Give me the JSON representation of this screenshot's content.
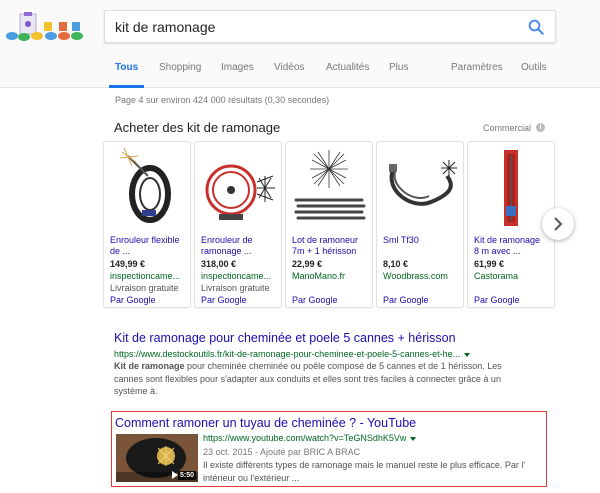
{
  "header": {
    "search_value": "kit de ramonage",
    "tabs": [
      {
        "label": "Tous",
        "active": true
      },
      {
        "label": "Shopping"
      },
      {
        "label": "Images"
      },
      {
        "label": "Vidéos"
      },
      {
        "label": "Actualités"
      },
      {
        "label": "Plus"
      },
      {
        "label": "Paramètres"
      },
      {
        "label": "Outils"
      }
    ]
  },
  "stats": "Page 4 sur environ 424 000 résultats (0,30 secondes)",
  "shopping": {
    "title": "Acheter des kit de ramonage",
    "commercial_label": "Commercial",
    "info_glyph": "i",
    "cards": [
      {
        "name_line1": "Enrouleur flexible",
        "name_line2": "de ...",
        "price": "149,99 €",
        "merchant": "inspectioncame...",
        "shipping": "Livraison gratuite",
        "by": "Par Google"
      },
      {
        "name_line1": "Enrouleur de",
        "name_line2": "ramonage ...",
        "price": "318,00 €",
        "merchant": "inspectioncame...",
        "shipping": "Livraison gratuite",
        "by": "Par Google"
      },
      {
        "name_line1": "Lot de ramoneur",
        "name_line2": "7m + 1 hérisson",
        "price": "22,99 €",
        "merchant": "ManoMano.fr",
        "shipping": "",
        "by": "Par Google"
      },
      {
        "name_line1": "Sml Tf30",
        "name_line2": "",
        "price": "8,10 €",
        "merchant": "Woodbrass.com",
        "shipping": "",
        "by": "Par Google"
      },
      {
        "name_line1": "Kit de ramonage",
        "name_line2": "8 m avec ...",
        "price": "61,99 €",
        "merchant": "Castorama",
        "shipping": "",
        "by": "Par Google"
      }
    ]
  },
  "results": [
    {
      "title": "Kit de ramonage pour cheminée et poele 5 cannes + hérisson",
      "url": "https://www.destockoutils.fr/kit-de-ramonage-pour-cheminee-et-poele-5-cannes-et-he...",
      "snippet_bold": "Kit de ramonage",
      "snippet_line1": " pour cheminée cheminée ou poêle composé de 5 cannes et de 1 hérisson. Les",
      "snippet_line2": "cannes sont flexibles pour s'adapter aux conduits et elles sont très faciles à connecter grâce à un",
      "snippet_line3": "système à."
    },
    {
      "title": "Comment ramoner un tuyau de cheminée ? - YouTube",
      "url": "https://www.youtube.com/watch?v=TeGNSdhK5Vw",
      "date": "23 oct. 2015 - Ajouté par BRIC A BRAC",
      "duration": "5:50",
      "snippet_line1": "Il existe différents types de ramonage mais le manuel reste le plus efficace. Par l'",
      "snippet_line2": "intérieur ou l'extérieur ..."
    }
  ],
  "colors": {
    "link": "#1a0dab",
    "url": "#006621",
    "accent": "#1a73e8",
    "highlight_border": "#e03a3a"
  }
}
